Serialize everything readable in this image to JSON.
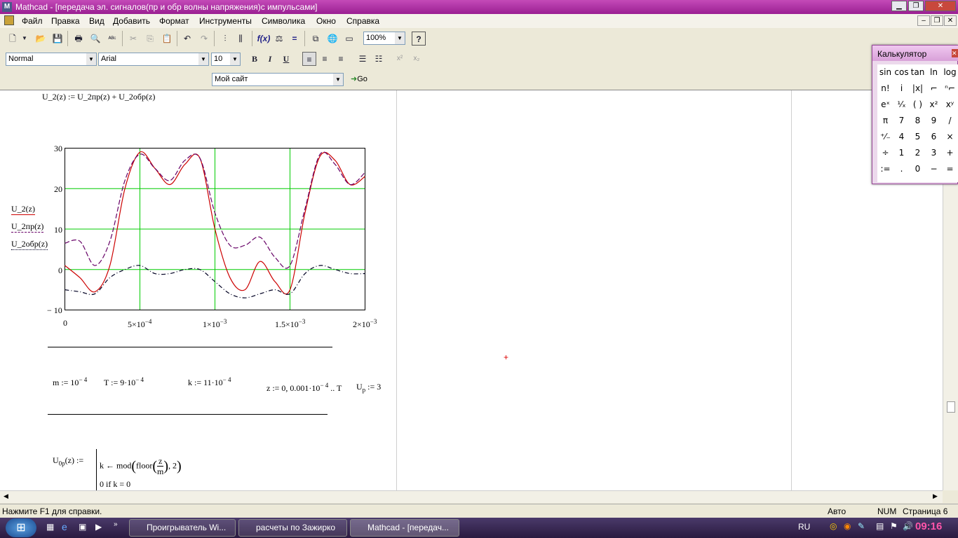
{
  "window": {
    "title": "Mathcad - [передача эл. сигналов(пр и обр волны напряжения)с импульсами]",
    "app_icon": "M"
  },
  "menu": [
    "Файл",
    "Правка",
    "Вид",
    "Добавить",
    "Формат",
    "Инструменты",
    "Символика",
    "Окно",
    "Справка"
  ],
  "toolbar": {
    "zoom": "100%",
    "style": "Normal",
    "font": "Arial",
    "size": "10",
    "bold": "B",
    "italic": "I",
    "underline": "U",
    "site": "Мой сайт",
    "go": "Go"
  },
  "worksheet": {
    "eq_u2": "U_2(z) := U_2пр(z) + U_2обр(z)",
    "legend": [
      "U_2(z)",
      "U_2пр(z)",
      "U_2обр(z)"
    ],
    "yticks": [
      "30",
      "20",
      "10",
      "0",
      "− 10"
    ],
    "xticks": [
      "0",
      "5×10",
      "1×10",
      "1.5×10",
      "2×10"
    ],
    "xexp": [
      "−4",
      "−3",
      "−3",
      "−3"
    ],
    "eq_m": "m := 10",
    "eq_m_exp": "− 4",
    "eq_T": "T := 9·10",
    "eq_T_exp": "− 4",
    "eq_k": "k := 11·10",
    "eq_k_exp": "− 4",
    "eq_z": "z := 0, 0.001·10",
    "eq_z_exp": "− 4",
    "eq_z_tail": ".. T",
    "eq_up": "U",
    "eq_up_sub": "p",
    "eq_up_tail": ":= 3",
    "eq_u0p": "U",
    "eq_u0p_sub": "0p",
    "eq_u0p_tail": "(z) :=",
    "prog_line1a": "k ← mod",
    "prog_floor": "floor",
    "prog_num": "z",
    "prog_den": "m",
    "prog_tail": ", 2",
    "prog_line2": "0  if  k = 0"
  },
  "chart_data": {
    "type": "line",
    "xlim": [
      0,
      0.002
    ],
    "ylim": [
      -10,
      30
    ],
    "grid": true,
    "series": [
      {
        "name": "U_2(z)",
        "color": "#cc0000",
        "style": "solid",
        "x": [
          0,
          0.0001,
          0.0002,
          0.0003,
          0.0004,
          0.0005,
          0.0006,
          0.0007,
          0.0008,
          0.0009,
          0.001,
          0.0011,
          0.0012,
          0.0013,
          0.0014,
          0.0015,
          0.0016,
          0.0017,
          0.0018,
          0.0019,
          0.002
        ],
        "y": [
          1,
          -2,
          -5.5,
          1,
          20,
          29,
          25,
          21,
          26,
          27.5,
          10,
          -2,
          -5,
          2,
          -3,
          -5,
          14,
          28,
          27,
          21,
          23
        ]
      },
      {
        "name": "U_2пр(z)",
        "color": "#660066",
        "style": "dashed",
        "x": [
          0,
          0.0001,
          0.0002,
          0.0003,
          0.0004,
          0.0005,
          0.0006,
          0.0007,
          0.0008,
          0.0009,
          0.001,
          0.0011,
          0.0012,
          0.0013,
          0.0014,
          0.0015,
          0.0016,
          0.0017,
          0.0018,
          0.0019,
          0.002
        ],
        "y": [
          6.5,
          7,
          1,
          7,
          22,
          28.5,
          25,
          22,
          27,
          27.5,
          14,
          6,
          6,
          8,
          3,
          1,
          15,
          28.5,
          26,
          21,
          24
        ]
      },
      {
        "name": "U_2обр(z)",
        "color": "#000022",
        "style": "dashdot",
        "x": [
          0,
          0.0001,
          0.0002,
          0.0003,
          0.0004,
          0.0005,
          0.0006,
          0.0007,
          0.0008,
          0.0009,
          0.001,
          0.0011,
          0.0012,
          0.0013,
          0.0014,
          0.0015,
          0.0016,
          0.0017,
          0.0018,
          0.0019,
          0.002
        ],
        "y": [
          -5,
          -5.5,
          -6,
          -2,
          0,
          1,
          -1,
          -1,
          0,
          0,
          -3,
          -6,
          -7,
          -6,
          -5,
          -6,
          -1,
          1,
          0,
          -1,
          -1
        ]
      }
    ]
  },
  "calculator": {
    "title": "Калькулятор",
    "keys": [
      "sin",
      "cos",
      "tan",
      "ln",
      "log",
      "n!",
      "i",
      "|x|",
      "⌐",
      "ⁿ⌐",
      "eˣ",
      "¹⁄ₓ",
      "( )",
      "x²",
      "xʸ",
      "π",
      "7",
      "8",
      "9",
      "/",
      "⁺⁄₋",
      "4",
      "5",
      "6",
      "×",
      "÷",
      "1",
      "2",
      "3",
      "+",
      ":=",
      ".",
      "0",
      "−",
      "="
    ]
  },
  "status": {
    "help": "Нажмите F1 для справки.",
    "mode": "Авто",
    "num": "NUM",
    "page": "Страница 6"
  },
  "taskbar": {
    "tasks": [
      "Проигрыватель Wi...",
      "расчеты по Зажирко",
      "Mathcad - [передач..."
    ],
    "lang": "RU",
    "time": "09:16"
  }
}
